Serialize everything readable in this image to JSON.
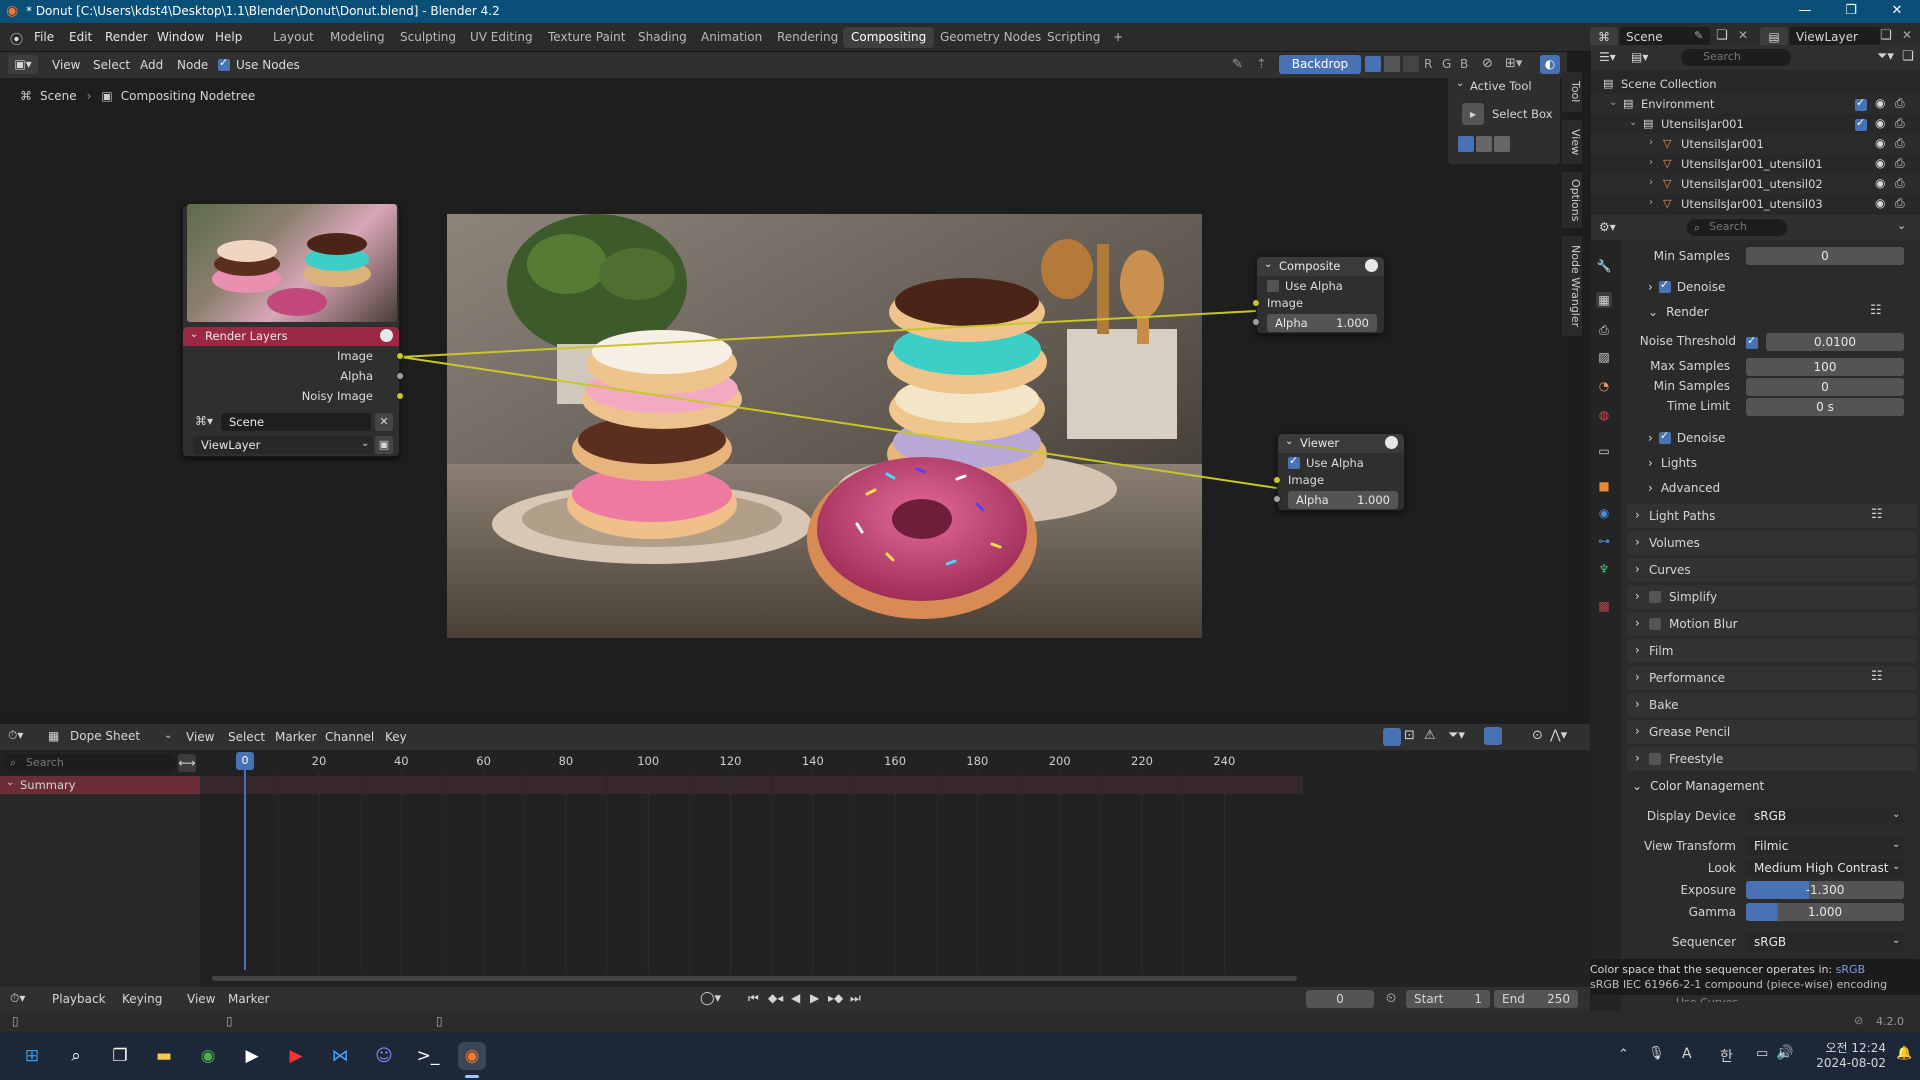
{
  "window": {
    "title": "* Donut [C:\\Users\\kdst4\\Desktop\\1.1\\Blender\\Donut\\Donut.blend] - Blender 4.2",
    "controls": [
      "—",
      "❐",
      "✕"
    ]
  },
  "menu": [
    "File",
    "Edit",
    "Render",
    "Window",
    "Help"
  ],
  "workspaces": [
    "Layout",
    "Modeling",
    "Sculpting",
    "UV Editing",
    "Texture Paint",
    "Shading",
    "Animation",
    "Rendering",
    "Compositing",
    "Geometry Nodes",
    "Scripting"
  ],
  "active_workspace": "Compositing",
  "scene_selector": "Scene",
  "viewlayer_selector": "ViewLayer",
  "node_editor": {
    "menus": [
      "View",
      "Select",
      "Add",
      "Node"
    ],
    "use_nodes_label": "Use Nodes",
    "backdrop_label": "Backdrop",
    "channels": [
      "R",
      "G",
      "B"
    ],
    "breadcrumb": [
      "Scene",
      "Compositing Nodetree"
    ],
    "side_tabs": [
      "Tool",
      "View",
      "Options",
      "Node Wrangler"
    ],
    "active_tool": {
      "title": "Active Tool",
      "tool": "Select Box"
    }
  },
  "nodes": {
    "render_layers": {
      "title": "Render Layers",
      "outputs": [
        "Image",
        "Alpha",
        "Noisy Image"
      ],
      "scene": "Scene",
      "view_layer": "ViewLayer"
    },
    "composite": {
      "title": "Composite",
      "use_alpha_label": "Use Alpha",
      "input_image": "Image",
      "alpha_label": "Alpha",
      "alpha_value": "1.000"
    },
    "viewer": {
      "title": "Viewer",
      "use_alpha_label": "Use Alpha",
      "input_image": "Image",
      "alpha_label": "Alpha",
      "alpha_value": "1.000"
    }
  },
  "outliner": {
    "search_placeholder": "Search",
    "items": [
      {
        "label": "Scene Collection",
        "depth": 0
      },
      {
        "label": "Environment",
        "depth": 1
      },
      {
        "label": "UtensilsJar001",
        "depth": 2
      },
      {
        "label": "UtensilsJar001",
        "depth": 3
      },
      {
        "label": "UtensilsJar001_utensil01",
        "depth": 3
      },
      {
        "label": "UtensilsJar001_utensil02",
        "depth": 3
      },
      {
        "label": "UtensilsJar001_utensil03",
        "depth": 3
      }
    ]
  },
  "properties": {
    "search_placeholder": "Search",
    "min_samples_top": {
      "label": "Min Samples",
      "value": "0"
    },
    "denoise_1": "Denoise",
    "render_panel": "Render",
    "noise_threshold": {
      "label": "Noise Threshold",
      "value": "0.0100"
    },
    "max_samples": {
      "label": "Max Samples",
      "value": "100"
    },
    "min_samples": {
      "label": "Min Samples",
      "value": "0"
    },
    "time_limit": {
      "label": "Time Limit",
      "value": "0 s"
    },
    "denoise_2": "Denoise",
    "lights": "Lights",
    "advanced": "Advanced",
    "panels": [
      "Light Paths",
      "Volumes",
      "Curves",
      "Simplify",
      "Motion Blur",
      "Film",
      "Performance",
      "Bake",
      "Grease Pencil",
      "Freestyle"
    ],
    "color_management": {
      "title": "Color Management",
      "display_device": {
        "label": "Display Device",
        "value": "sRGB"
      },
      "view_transform": {
        "label": "View Transform",
        "value": "Filmic"
      },
      "look": {
        "label": "Look",
        "value": "Medium High Contrast"
      },
      "exposure": {
        "label": "Exposure",
        "value": "-1.300"
      },
      "gamma": {
        "label": "Gamma",
        "value": "1.000"
      },
      "sequencer": {
        "label": "Sequencer",
        "value": "sRGB"
      }
    },
    "tooltip": {
      "line1": "Color space that the sequencer operates in:",
      "line1_value": "sRGB",
      "line2": "sRGB IEC 61966-2-1 compound (piece-wise) encoding"
    },
    "cut_off_item": "Use Curves"
  },
  "dopesheet": {
    "mode": "Dope Sheet",
    "menus": [
      "View",
      "Select",
      "Marker",
      "Channel",
      "Key"
    ],
    "search_placeholder": "Search",
    "summary": "Summary",
    "current_frame": "0",
    "ruler": [
      "20",
      "40",
      "60",
      "80",
      "100",
      "120",
      "140",
      "160",
      "180",
      "200",
      "220",
      "240"
    ]
  },
  "timeline": {
    "menus": [
      "Playback",
      "Keying",
      "View",
      "Marker"
    ],
    "frame": "0",
    "start_label": "Start",
    "start": "1",
    "end_label": "End",
    "end": "250"
  },
  "status": {
    "version": "4.2.0"
  },
  "taskbar": {
    "time": "오전 12:24",
    "date": "2024-08-02",
    "ime": "A",
    "lang": "한"
  },
  "colors": {
    "accent": "#4772b3",
    "render_layers_header": "#9b2946",
    "output_header": "#3b3b3b",
    "socket_image": "#c7c729",
    "title_bar": "#0a4f78"
  }
}
